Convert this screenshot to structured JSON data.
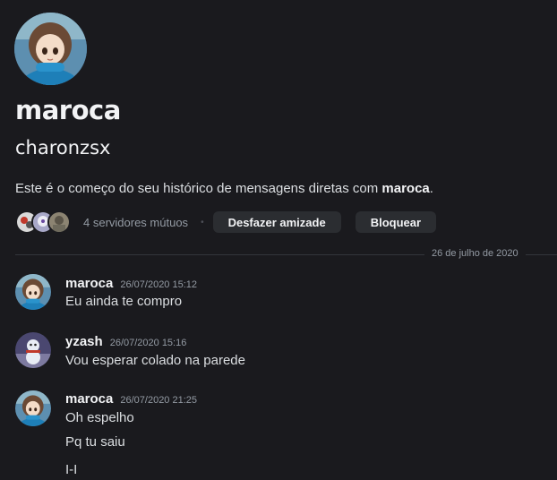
{
  "profile": {
    "display_name": "maroca",
    "username": "charonzsx",
    "intro_prefix": "Este é o começo do seu histórico de mensagens diretas com ",
    "intro_name": "maroca",
    "intro_suffix": "."
  },
  "mutual": {
    "count_text": "4 servidores mútuos",
    "separator": "•"
  },
  "actions": {
    "unfriend_label": "Desfazer amizade",
    "block_label": "Bloquear"
  },
  "date_divider": "26 de julho de 2020",
  "messages": [
    {
      "author": "maroca",
      "time": "26/07/2020 15:12",
      "lines": [
        "Eu ainda te compro"
      ]
    },
    {
      "author": "yzash",
      "time": "26/07/2020 15:16",
      "lines": [
        "Vou esperar colado na parede"
      ]
    },
    {
      "author": "maroca",
      "time": "26/07/2020 21:25",
      "lines": [
        "Oh espelho",
        "Pq tu saiu",
        "I-I"
      ]
    }
  ],
  "colors": {
    "background": "#1a1a1e",
    "button_bg": "#2b2d31",
    "muted_text": "#949ba4"
  }
}
